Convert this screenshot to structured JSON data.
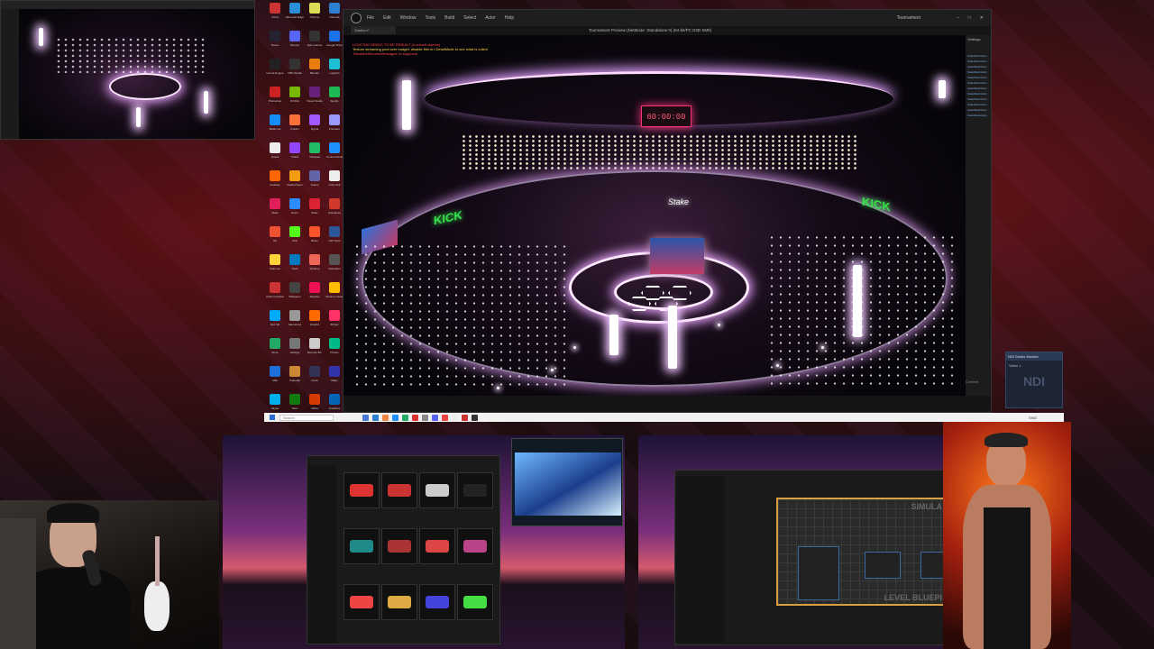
{
  "main_window": {
    "title": "Tournament Preview (NetMode: Standalone 0) (64-bit/PC D3D SM6)",
    "app_tab": "Stadium*",
    "menu": [
      "File",
      "Edit",
      "Window",
      "Tools",
      "Build",
      "Select",
      "Actor",
      "Help"
    ],
    "project_label": "Tournament",
    "settings_label": "Settings",
    "log_lines": [
      "LIGHTING NEEDS TO BE REBUILT (# unbuilt objects)",
      "Texture streaming pool over budget, disable this in r.DetailMode to see what is culled",
      "'DisableAllScreenMessages' to suppress"
    ],
    "scoreboard": "60:00:00",
    "kick_left": "KICK",
    "kick_right": "KICK",
    "stake_logo": "Stake",
    "outliner_item": "StaticMeshActor",
    "bottom_label": "Content"
  },
  "desktop_icons": [
    {
      "label": "Citrus",
      "color": "#c33"
    },
    {
      "label": "Microsoft Edge",
      "color": "#2a8fd8"
    },
    {
      "label": "Chrome",
      "color": "#dd5"
    },
    {
      "label": "VSCode",
      "color": "#2d7fd1"
    },
    {
      "label": "Steam",
      "color": "#223"
    },
    {
      "label": "Discord",
      "color": "#5865f2"
    },
    {
      "label": "Epic Games",
      "color": "#333"
    },
    {
      "label": "Google Drive",
      "color": "#1a73e8"
    },
    {
      "label": "Unreal Engine",
      "color": "#222"
    },
    {
      "label": "OBS Studio",
      "color": "#333"
    },
    {
      "label": "Blender",
      "color": "#e87d0d"
    },
    {
      "label": "Logitech",
      "color": "#1cbfd4"
    },
    {
      "label": "Photoshop",
      "color": "#c22"
    },
    {
      "label": "NVIDIA",
      "color": "#76b900"
    },
    {
      "label": "Visual Studio",
      "color": "#68217a"
    },
    {
      "label": "Spotify",
      "color": "#1db954"
    },
    {
      "label": "Battle.net",
      "color": "#148eff"
    },
    {
      "label": "Firefox",
      "color": "#ff7139"
    },
    {
      "label": "Figma",
      "color": "#a259ff"
    },
    {
      "label": "Premiere",
      "color": "#9999ff"
    },
    {
      "label": "Quixel",
      "color": "#eee"
    },
    {
      "label": "Twitch",
      "color": "#9146ff"
    },
    {
      "label": "Notepad",
      "color": "#2b6"
    },
    {
      "label": "Control Panel",
      "color": "#1e90ff"
    },
    {
      "label": "Audacity",
      "color": "#f60"
    },
    {
      "label": "Media Player",
      "color": "#f39c12"
    },
    {
      "label": "Teams",
      "color": "#6264a7"
    },
    {
      "label": "Unity Hub",
      "color": "#eee"
    },
    {
      "label": "Slack",
      "color": "#e01e5a"
    },
    {
      "label": "Zoom",
      "color": "#2d8cff"
    },
    {
      "label": "Rider",
      "color": "#d23"
    },
    {
      "label": "Substance",
      "color": "#d1392c"
    },
    {
      "label": "Git",
      "color": "#f05133"
    },
    {
      "label": "Kick",
      "color": "#53fc18"
    },
    {
      "label": "Brave",
      "color": "#fb542b"
    },
    {
      "label": "NDI Tools",
      "color": "#2b5797"
    },
    {
      "label": "Paint.net",
      "color": "#ffd43b"
    },
    {
      "label": "Trello",
      "color": "#0079bf"
    },
    {
      "label": "Winamp",
      "color": "#e65"
    },
    {
      "label": "Calculator",
      "color": "#555"
    },
    {
      "label": "Audio Interface",
      "color": "#c33"
    },
    {
      "label": "Wallpaper",
      "color": "#444"
    },
    {
      "label": "Resolve",
      "color": "#e15"
    },
    {
      "label": "Chrome Canary",
      "color": "#fb0"
    },
    {
      "label": "Daz 3D",
      "color": "#0af"
    },
    {
      "label": "Marvelous",
      "color": "#999"
    },
    {
      "label": "Houdini",
      "color": "#ff6a00"
    },
    {
      "label": "Bridge",
      "color": "#ff3366"
    },
    {
      "label": "Store",
      "color": "#2a6"
    },
    {
      "label": "Settings",
      "color": "#777"
    },
    {
      "label": "Recycle Bin",
      "color": "#ccc"
    },
    {
      "label": "Photos",
      "color": "#0b8"
    },
    {
      "label": "Mail",
      "color": "#1e6fd9"
    },
    {
      "label": "Calendar",
      "color": "#c83"
    },
    {
      "label": "Clock",
      "color": "#335"
    },
    {
      "label": "Maps",
      "color": "#33a"
    },
    {
      "label": "Skype",
      "color": "#00aff0"
    },
    {
      "label": "Xbox",
      "color": "#107c10"
    },
    {
      "label": "Office",
      "color": "#d83b01"
    },
    {
      "label": "OneDrive",
      "color": "#0364b8"
    }
  ],
  "taskbar": {
    "search_placeholder": "Search",
    "apps": [
      "#4b7bd8",
      "#2d7fd1",
      "#e84",
      "#1e90ff",
      "#2a6",
      "#d33",
      "#888",
      "#5865f2",
      "#e44",
      "#eee",
      "#c33",
      "#333"
    ],
    "time": "",
    "keyboard": "ENG"
  },
  "ndi_window": {
    "title": "NDI Studio Monitor",
    "source": "Video 1",
    "logo": "NDI"
  },
  "content_browser": {
    "thumb_colors": [
      "#d33",
      "#c33",
      "#ccc",
      "#222",
      "#1e8a8a",
      "#a33",
      "#d44",
      "#b48",
      "#e44",
      "#da4",
      "#44d",
      "#4d4"
    ]
  },
  "blueprint_window": {
    "watermark_top": "SIMULA",
    "watermark_bottom": "LEVEL BLUEPI"
  }
}
